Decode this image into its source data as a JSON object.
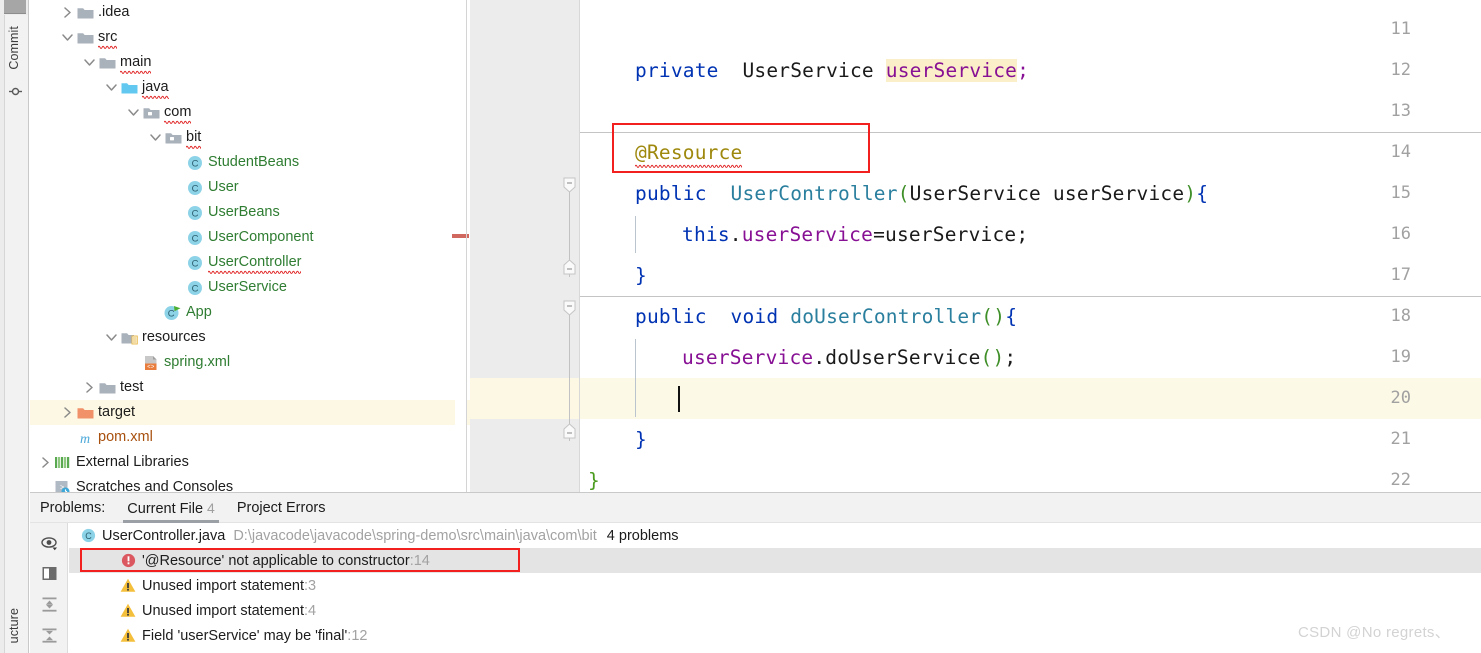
{
  "tool_strip": {
    "commit_label": "Commit",
    "structure_label": "ucture",
    "commit_icon": "commit-icon"
  },
  "project_tree": {
    "items": [
      {
        "label": ".idea",
        "indent": 1,
        "arrow": "right",
        "icon": "folder-gray",
        "color": "dark",
        "spell": false,
        "selected": false
      },
      {
        "label": "src",
        "indent": 1,
        "arrow": "down",
        "icon": "folder-gray",
        "color": "dark",
        "spell": true,
        "selected": false
      },
      {
        "label": "main",
        "indent": 2,
        "arrow": "down",
        "icon": "folder-gray",
        "color": "dark",
        "spell": true,
        "selected": false
      },
      {
        "label": "java",
        "indent": 3,
        "arrow": "down",
        "icon": "folder-blue",
        "color": "dark",
        "spell": true,
        "selected": false
      },
      {
        "label": "com",
        "indent": 4,
        "arrow": "down",
        "icon": "folder-pkg",
        "color": "dark",
        "spell": true,
        "selected": false
      },
      {
        "label": "bit",
        "indent": 5,
        "arrow": "down",
        "icon": "folder-pkg",
        "color": "dark",
        "spell": true,
        "selected": false
      },
      {
        "label": "StudentBeans",
        "indent": 6,
        "arrow": "none",
        "icon": "class-icon",
        "color": "green",
        "spell": false,
        "selected": false
      },
      {
        "label": "User",
        "indent": 6,
        "arrow": "none",
        "icon": "class-icon",
        "color": "green",
        "spell": false,
        "selected": false
      },
      {
        "label": "UserBeans",
        "indent": 6,
        "arrow": "none",
        "icon": "class-icon",
        "color": "green",
        "spell": false,
        "selected": false
      },
      {
        "label": "UserComponent",
        "indent": 6,
        "arrow": "none",
        "icon": "class-icon",
        "color": "green",
        "spell": false,
        "selected": false
      },
      {
        "label": "UserController",
        "indent": 6,
        "arrow": "none",
        "icon": "class-icon",
        "color": "green",
        "spell": true,
        "selected": false
      },
      {
        "label": "UserService",
        "indent": 6,
        "arrow": "none",
        "icon": "class-icon",
        "color": "green",
        "spell": false,
        "selected": false
      },
      {
        "label": "App",
        "indent": 5,
        "arrow": "none",
        "icon": "class-run-icon",
        "color": "green",
        "spell": false,
        "selected": false
      },
      {
        "label": "resources",
        "indent": 3,
        "arrow": "down",
        "icon": "folder-res",
        "color": "dark",
        "spell": false,
        "selected": false
      },
      {
        "label": "spring.xml",
        "indent": 4,
        "arrow": "none",
        "icon": "xml-icon",
        "color": "green",
        "spell": false,
        "selected": false
      },
      {
        "label": "test",
        "indent": 2,
        "arrow": "right",
        "icon": "folder-gray",
        "color": "dark",
        "spell": false,
        "selected": false
      },
      {
        "label": "target",
        "indent": 1,
        "arrow": "right",
        "icon": "folder-orange",
        "color": "dark",
        "spell": false,
        "selected": true
      },
      {
        "label": "pom.xml",
        "indent": 1,
        "arrow": "none",
        "icon": "maven-icon",
        "color": "orange",
        "spell": false,
        "selected": false
      },
      {
        "label": "External Libraries",
        "indent": 0,
        "arrow": "right",
        "icon": "libs-icon",
        "color": "dark",
        "spell": false,
        "selected": false
      },
      {
        "label": "Scratches and Consoles",
        "indent": 0,
        "arrow": "none",
        "icon": "scratch-icon",
        "color": "dark",
        "spell": false,
        "selected": false
      }
    ]
  },
  "editor": {
    "line_numbers": [
      "11",
      "12",
      "13",
      "14",
      "15",
      "16",
      "17",
      "18",
      "19",
      "20",
      "21",
      "22"
    ],
    "current_line": "20",
    "lines": [
      {
        "num": "11",
        "tokens": []
      },
      {
        "num": "12",
        "tokens": [
          {
            "t": "private",
            "c": "kw"
          },
          {
            "t": "  ",
            "c": "plain"
          },
          {
            "t": "UserService",
            "c": "plain"
          },
          {
            "t": " ",
            "c": "plain"
          },
          {
            "t": "userService",
            "c": "fld-hl"
          },
          {
            "t": ";",
            "c": "fld"
          }
        ],
        "indent": 1
      },
      {
        "num": "13",
        "tokens": []
      },
      {
        "num": "14",
        "tokens": [
          {
            "t": "@Resource",
            "c": "anno"
          }
        ],
        "indent": 1
      },
      {
        "num": "15",
        "tokens": [
          {
            "t": "public",
            "c": "kw"
          },
          {
            "t": "  ",
            "c": "plain"
          },
          {
            "t": "UserController",
            "c": "typ"
          },
          {
            "t": "(",
            "c": "grn"
          },
          {
            "t": "UserService userService",
            "c": "plain"
          },
          {
            "t": ")",
            "c": "grn"
          },
          {
            "t": "{",
            "c": "kw"
          }
        ],
        "indent": 1
      },
      {
        "num": "16",
        "tokens": [
          {
            "t": "this",
            "c": "kw"
          },
          {
            "t": ".",
            "c": "plain"
          },
          {
            "t": "userService",
            "c": "fld"
          },
          {
            "t": "=userService;",
            "c": "plain"
          }
        ],
        "indent": 2
      },
      {
        "num": "17",
        "tokens": [
          {
            "t": "}",
            "c": "kw"
          }
        ],
        "indent": 1
      },
      {
        "num": "18",
        "tokens": [
          {
            "t": "public",
            "c": "kw"
          },
          {
            "t": "  ",
            "c": "plain"
          },
          {
            "t": "void",
            "c": "kw"
          },
          {
            "t": " ",
            "c": "plain"
          },
          {
            "t": "doUserController",
            "c": "typ"
          },
          {
            "t": "()",
            "c": "grn"
          },
          {
            "t": "{",
            "c": "kw"
          }
        ],
        "indent": 1
      },
      {
        "num": "19",
        "tokens": [
          {
            "t": "userService",
            "c": "fld"
          },
          {
            "t": ".doUserService",
            "c": "plain"
          },
          {
            "t": "()",
            "c": "grn"
          },
          {
            "t": ";",
            "c": "plain"
          }
        ],
        "indent": 2
      },
      {
        "num": "20",
        "tokens": [],
        "indent": 2
      },
      {
        "num": "21",
        "tokens": [
          {
            "t": "}",
            "c": "kw"
          }
        ],
        "indent": 1
      },
      {
        "num": "22",
        "tokens": [
          {
            "t": "}",
            "c": "grn2"
          }
        ],
        "indent": 0
      }
    ],
    "annotation_highlight": "@Resource"
  },
  "problems": {
    "title": "Problems:",
    "tabs": [
      {
        "label": "Current File",
        "count": "4",
        "active": true
      },
      {
        "label": "Project Errors",
        "count": "",
        "active": false
      }
    ],
    "side_icons": [
      "eye-icon",
      "split-view-icon",
      "expand-all-icon",
      "collapse-all-icon"
    ],
    "file": {
      "name": "UserController.java",
      "path": "D:\\javacode\\javacode\\spring-demo\\src\\main\\java\\com\\bit",
      "count": "4 problems",
      "icon": "class-icon"
    },
    "rows": [
      {
        "severity": "error",
        "text": "'@Resource' not applicable to constructor",
        "line": ":14",
        "selected": true,
        "boxed": true
      },
      {
        "severity": "warning",
        "text": "Unused import statement",
        "line": ":3",
        "selected": false,
        "boxed": false
      },
      {
        "severity": "warning",
        "text": "Unused import statement",
        "line": ":4",
        "selected": false,
        "boxed": false
      },
      {
        "severity": "warning",
        "text": "Field 'userService' may be 'final'",
        "line": ":12",
        "selected": false,
        "boxed": false
      }
    ]
  },
  "watermark": {
    "text": "CSDN @No regrets、"
  },
  "colors": {
    "keyword": "#0033b3",
    "type": "#2a7f9e",
    "field": "#871094",
    "annotation": "#9e880d",
    "error_red": "#f32020",
    "selected_row": "#fdf8e3",
    "tree_green": "#2f7d32"
  }
}
